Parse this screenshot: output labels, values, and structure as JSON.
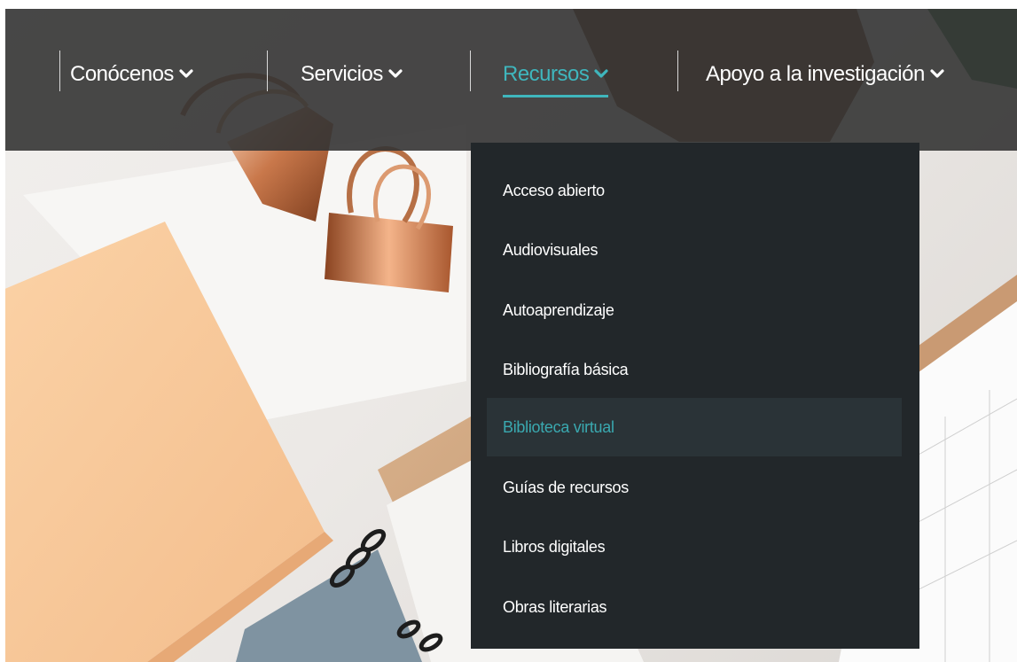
{
  "nav": {
    "items": [
      {
        "label": "Conócenos",
        "icon": "chevron-down-icon",
        "active": false
      },
      {
        "label": "Servicios",
        "icon": "chevron-down-icon",
        "active": false
      },
      {
        "label": "Recursos",
        "icon": "chevron-down-icon",
        "active": true
      },
      {
        "label": "Apoyo a la investigación",
        "icon": "chevron-down-icon",
        "active": false
      }
    ]
  },
  "dropdown": {
    "items": [
      {
        "label": "Acceso abierto"
      },
      {
        "label": "Audiovisuales"
      },
      {
        "label": "Autoaprendizaje"
      },
      {
        "label": "Bibliografía básica"
      },
      {
        "label": "Biblioteca virtual",
        "highlighted": true
      },
      {
        "label": "Guías de recursos"
      },
      {
        "label": "Libros digitales"
      },
      {
        "label": "Obras literarias"
      }
    ]
  },
  "colors": {
    "accent": "#3fb6bd",
    "navbar": "#343434",
    "dropdown_bg": "#22272a",
    "dropdown_hover": "#2a3337",
    "text": "#ffffff"
  }
}
